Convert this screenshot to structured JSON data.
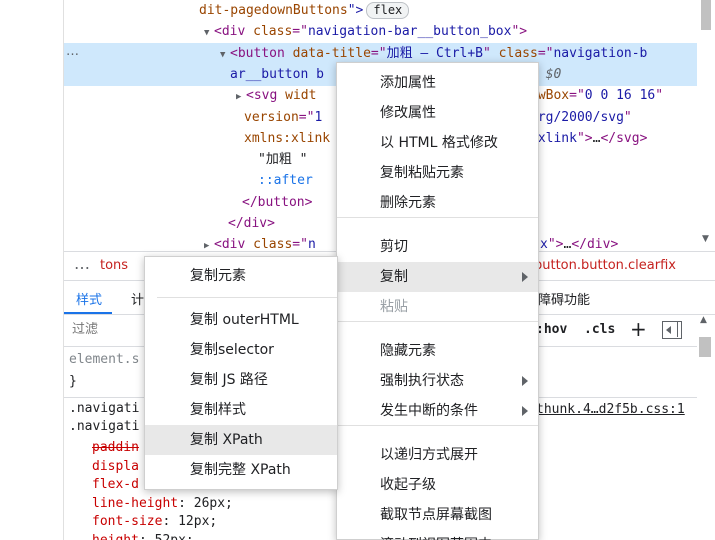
{
  "tree": {
    "lines": [
      {
        "indent": 203,
        "parts": [
          {
            "c": "attr",
            "t": "dit-pagedownButtons"
          },
          {
            "c": "val",
            "t": "\">"
          }
        ],
        "badge": "flex",
        "tri": ""
      },
      {
        "indent": 218,
        "parts": [
          {
            "c": "tag",
            "t": "<div "
          },
          {
            "c": "attr",
            "t": "class"
          },
          {
            "c": "tag",
            "t": "=\""
          },
          {
            "c": "val",
            "t": "navigation-bar__button_box"
          },
          {
            "c": "tag",
            "t": "\">"
          }
        ],
        "tri": "▼"
      },
      {
        "indent": 234,
        "parts": [
          {
            "c": "tag",
            "t": "<button "
          },
          {
            "c": "attr",
            "t": "data-title"
          },
          {
            "c": "tag",
            "t": "=\""
          },
          {
            "c": "val",
            "t": "加粗 – Ctrl+B"
          },
          {
            "c": "tag",
            "t": "\" "
          },
          {
            "c": "attr",
            "t": "class"
          },
          {
            "c": "tag",
            "t": "=\""
          },
          {
            "c": "val",
            "t": "navigation-b"
          }
        ],
        "tri": "▼"
      },
      {
        "indent": 234,
        "parts": [
          {
            "c": "val",
            "t": "ar__button b"
          }
        ],
        "tri": "",
        "tail": "= $0"
      },
      {
        "indent": 250,
        "parts": [
          {
            "c": "tag",
            "t": "<svg "
          },
          {
            "c": "attr",
            "t": "widt"
          }
        ],
        "tri": "▶",
        "right": [
          {
            "c": "attr",
            "t": "ewBox"
          },
          {
            "c": "tag",
            "t": "=\""
          },
          {
            "c": "val",
            "t": "0 0 16 16"
          },
          {
            "c": "tag",
            "t": "\""
          }
        ]
      },
      {
        "indent": 248,
        "parts": [
          {
            "c": "attr",
            "t": "version"
          },
          {
            "c": "tag",
            "t": "=\""
          },
          {
            "c": "val",
            "t": "1"
          }
        ],
        "tri": "",
        "right": [
          {
            "c": "val",
            "t": "org/2000/svg"
          },
          {
            "c": "tag",
            "t": "\""
          }
        ]
      },
      {
        "indent": 248,
        "parts": [
          {
            "c": "attr",
            "t": "xmlns:xlink"
          }
        ],
        "tri": "",
        "right": [
          {
            "c": "val",
            "t": "/xlink"
          },
          {
            "c": "tag",
            "t": "\">"
          },
          {
            "c": "txt",
            "t": "…"
          },
          {
            "c": "tag",
            "t": "</svg>"
          }
        ]
      },
      {
        "indent": 262,
        "parts": [
          {
            "c": "txt",
            "t": "\"加粗 \""
          }
        ],
        "tri": ""
      },
      {
        "indent": 262,
        "parts": [
          {
            "c": "pseudo",
            "t": "::after"
          }
        ],
        "tri": ""
      },
      {
        "indent": 246,
        "parts": [
          {
            "c": "tag",
            "t": "</button>"
          }
        ],
        "tri": ""
      },
      {
        "indent": 232,
        "parts": [
          {
            "c": "tag",
            "t": "</div>"
          }
        ],
        "tri": ""
      },
      {
        "indent": 218,
        "parts": [
          {
            "c": "tag",
            "t": "<div "
          },
          {
            "c": "attr",
            "t": "class"
          },
          {
            "c": "tag",
            "t": "=\""
          },
          {
            "c": "val",
            "t": "n"
          }
        ],
        "tri": "▶",
        "right": [
          {
            "c": "val",
            "t": "x"
          },
          {
            "c": "tag",
            "t": "\">"
          },
          {
            "c": "txt",
            "t": "…"
          },
          {
            "c": "tag",
            "t": "</div>"
          }
        ]
      }
    ]
  },
  "gutter_dots": "…",
  "breadcrumb": {
    "dots": "…",
    "left": "tons",
    "right": "button.button.clearfix"
  },
  "tabs": {
    "styles": "样式",
    "computed": "计",
    "accessibility": "障碍功能"
  },
  "filter": {
    "placeholder": "过滤",
    "hov": ":hov",
    "cls": ".cls",
    "plus": "+"
  },
  "styles_pane": {
    "element_style": "element.s",
    "close_brace": "}",
    "rule1": ".navigati",
    "rule2": ".navigati",
    "source_link": "thunk.4…d2f5b.css:1",
    "props": [
      {
        "name": "paddin",
        "val": "",
        "strike": true
      },
      {
        "name": "displa",
        "val": "",
        "strike": false
      },
      {
        "name": "flex-d",
        "val": "",
        "strike": false
      },
      {
        "name": "line-height",
        "val": "26px;",
        "strike": false
      },
      {
        "name": "font-size",
        "val": "12px;",
        "strike": false
      },
      {
        "name": "height",
        "val": "52px;",
        "strike": false
      }
    ]
  },
  "main_menu": {
    "items": [
      "添加属性",
      "修改属性",
      "以 HTML 格式修改",
      "复制粘贴元素",
      "删除元素",
      "剪切",
      "复制",
      "粘贴",
      "隐藏元素",
      "强制执行状态",
      "发生中断的条件",
      "以递归方式展开",
      "收起子级",
      "截取节点屏幕截图",
      "滚动到视图范围内"
    ]
  },
  "copy_menu": {
    "items": [
      "复制元素",
      "复制 outerHTML",
      "复制selector",
      "复制 JS 路径",
      "复制样式",
      "复制 XPath",
      "复制完整 XPath"
    ]
  }
}
